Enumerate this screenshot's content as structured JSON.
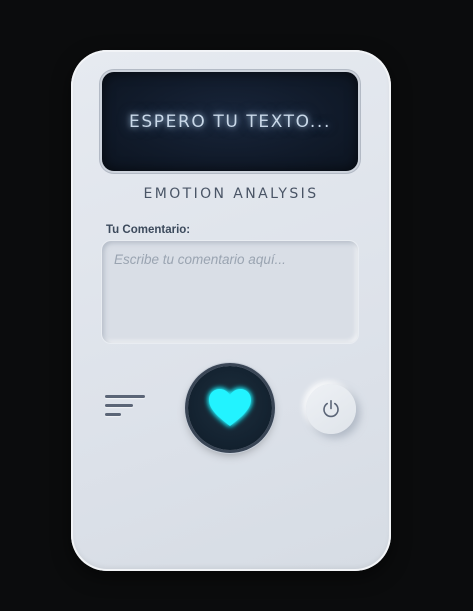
{
  "display": {
    "text": "ESPERO TU TEXTO..."
  },
  "brand": {
    "title": "EMOTION ANALYSIS"
  },
  "comment": {
    "label": "Tu Comentario:",
    "placeholder": "Escribe tu comentario aquí...",
    "value": ""
  },
  "controls": {
    "menu_icon": "menu-lines-icon",
    "analyze_icon": "heart-icon",
    "power_icon": "power-icon"
  },
  "colors": {
    "heart_glow": "#00f0ff",
    "screen_bg": "#111b2b",
    "device_bg": "#dde2ea"
  }
}
